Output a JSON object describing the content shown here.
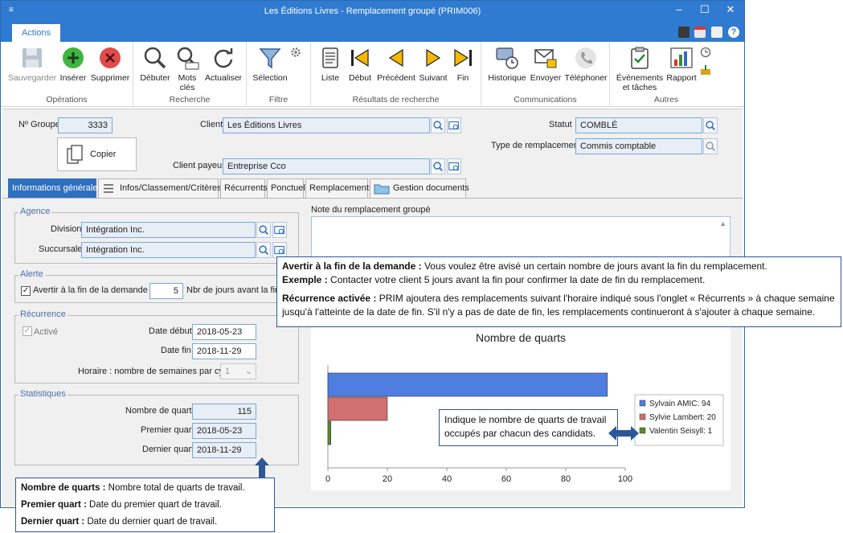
{
  "window": {
    "title": "Les Éditions Livres - Remplacement groupé (PRIM006)",
    "tab": "Actions"
  },
  "ribbon": {
    "groups": [
      {
        "label": "Opérations",
        "buttons": [
          "Sauvegarder",
          "Insérer",
          "Supprimer"
        ]
      },
      {
        "label": "Recherche",
        "buttons": [
          "Débuter",
          "Mots clés",
          "Actualiser"
        ]
      },
      {
        "label": "Filtre",
        "buttons": [
          "Sélection"
        ]
      },
      {
        "label": "Résultats de recherche",
        "buttons": [
          "Liste",
          "Début",
          "Précédent",
          "Suivant",
          "Fin"
        ]
      },
      {
        "label": "Communications",
        "buttons": [
          "Historique",
          "Envoyer",
          "Téléphoner"
        ]
      },
      {
        "label": "Autres",
        "buttons": [
          "Évènements et tâches",
          "Rapport"
        ]
      }
    ]
  },
  "header": {
    "group_no_label": "Nº Groupe",
    "group_no": "3333",
    "copy_label": "Copier",
    "client_label": "Client",
    "client": "Les Éditions Livres",
    "payer_label": "Client payeur",
    "payer": "Entreprise Cco",
    "status_label": "Statut",
    "status": "COMBLÉ",
    "type_label": "Type de remplacement",
    "type": "Commis comptable"
  },
  "tabs": [
    "Informations générales",
    "Infos/Classement/Critères",
    "Récurrents",
    "Ponctuel",
    "Remplacements",
    "Gestion documents"
  ],
  "agence": {
    "legend": "Agence",
    "division_label": "Division",
    "division": "Intégration Inc.",
    "succursale_label": "Succursale",
    "succursale": "Intégration Inc."
  },
  "alerte": {
    "legend": "Alerte",
    "check_label": "Avertir à la fin de la demande",
    "days": "5",
    "days_label": "Nbr de jours avant la fin"
  },
  "recurrence": {
    "legend": "Récurrence",
    "active_label": "Activé",
    "start_label": "Date début",
    "start": "2018-05-23",
    "end_label": "Date fin",
    "end": "2018-11-29",
    "schedule_label": "Horaire : nombre de semaines par cycle",
    "schedule": "1"
  },
  "stats": {
    "legend": "Statistiques",
    "shifts_label": "Nombre de quarts",
    "shifts": "115",
    "first_label": "Premier quart",
    "first": "2018-05-23",
    "last_label": "Dernier quart",
    "last": "2018-11-29"
  },
  "note_label": "Note du remplacement groupé",
  "callout_top": {
    "l1_b": "Avertir à la fin de la demande :",
    "l1": " Vous voulez être avisé un certain nombre de jours avant la fin du remplacement.",
    "l2_b": "Exemple :",
    "l2": " Contacter votre client 5 jours avant la fin pour confirmer la date de fin du remplacement.",
    "l3_b": "Récurrence activée :",
    "l3": " PRIM ajoutera des remplacements suivant l'horaire indiqué sous l'onglet « Récurrents » à chaque semaine",
    "l4": "jusqu'à l'atteinte de la date de fin. S'il n'y a pas de date de fin, les remplacements continueront à s'ajouter à chaque semaine."
  },
  "callout_chart": {
    "l1": "Indique le nombre de quarts de travail",
    "l2": "occupés par chacun des candidats."
  },
  "callout_stats": {
    "l1_b": "Nombre de quarts :",
    "l1": " Nombre total de quarts de travail.",
    "l2_b": "Premier quart :",
    "l2": " Date du premier quart de travail.",
    "l3_b": "Dernier quart :",
    "l3": " Date du dernier quart de travail."
  },
  "chart_data": {
    "type": "bar",
    "orientation": "horizontal",
    "title": "Nombre de quarts",
    "categories": [
      "Sylvain AMIC",
      "Sylvie Lambert",
      "Valentin Seisyll"
    ],
    "values": [
      94,
      20,
      1
    ],
    "colors": [
      "#4f7ee0",
      "#d07070",
      "#5c8a2a"
    ],
    "legend": [
      "Sylvain AMIC: 94",
      "Sylvie Lambert: 20",
      "Valentin Seisyll: 1"
    ],
    "xlim": [
      0,
      100
    ],
    "xticks": [
      "0",
      "20",
      "40",
      "60",
      "80",
      "100"
    ],
    "legend_position": "right"
  }
}
